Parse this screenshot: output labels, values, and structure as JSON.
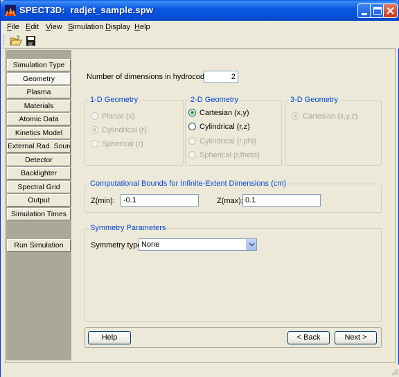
{
  "window": {
    "app_name": "SPECT3D:",
    "file_name": "radjet_sample.spw"
  },
  "menu": [
    {
      "label": "File",
      "mnemonic": "F",
      "rest": "ile"
    },
    {
      "label": "Edit",
      "mnemonic": "E",
      "rest": "dit"
    },
    {
      "label": "View",
      "mnemonic": "V",
      "rest": "iew"
    },
    {
      "label": "Simulation",
      "mnemonic": "S",
      "rest": "imulation"
    },
    {
      "label": "Display",
      "mnemonic": "D",
      "rest": "isplay"
    },
    {
      "label": "Help",
      "mnemonic": "H",
      "rest": "elp"
    }
  ],
  "toolbar": {
    "open_icon": "folder-open-icon",
    "save_icon": "floppy-save-icon"
  },
  "sidebar": {
    "items": [
      {
        "label": "Simulation Type"
      },
      {
        "label": "Geometry",
        "active": true
      },
      {
        "label": "Plasma"
      },
      {
        "label": "Materials"
      },
      {
        "label": "Atomic Data"
      },
      {
        "label": "Kinetics Model"
      },
      {
        "label": "External Rad. Source"
      },
      {
        "label": "Detector"
      },
      {
        "label": "Backlighter"
      },
      {
        "label": "Spectral Grid"
      },
      {
        "label": "Output"
      },
      {
        "label": "Simulation Times"
      }
    ],
    "run_label": "Run Simulation"
  },
  "geometry": {
    "dims_label": "Number of dimensions in hydrocode file:",
    "dims_value": "2",
    "geo1d": {
      "title": "1-D Geometry",
      "options": [
        "Planar (x)",
        "Cylindrical (r)",
        "Spherical (r)"
      ],
      "selected": "Cylindrical (r)",
      "enabled": false
    },
    "geo2d": {
      "title": "2-D Geometry",
      "options": [
        "Cartesian (x,y)",
        "Cylindrical (r,z)",
        "Cylindrical (r,phi)",
        "Spherical (r,theta)"
      ],
      "selected": "Cartesian (x,y)",
      "enabled_options": [
        "Cartesian (x,y)",
        "Cylindrical (r,z)"
      ]
    },
    "geo3d": {
      "title": "3-D Geometry",
      "options": [
        "Cartesian (x,y,z)"
      ],
      "selected": "Cartesian (x,y,z)",
      "enabled": false
    },
    "bounds": {
      "title": "Computational Bounds for Infinite-Extent Dimensions (cm)",
      "zmin_label": "Z(min):",
      "zmin_value": "-0.1",
      "zmax_label": "Z(max):",
      "zmax_value": "0.1"
    },
    "symmetry": {
      "title": "Symmetry Parameters",
      "type_label": "Symmetry type:",
      "type_value": "None"
    }
  },
  "footer": {
    "help_label": "Help",
    "back_label": "< Back",
    "next_label": "Next >"
  },
  "colors": {
    "titlebar": "#0551dc",
    "group_title": "#0046d5",
    "radio_dot": "#21a121",
    "sidebar_bg": "#aca899",
    "window_bg": "#ece9d8"
  }
}
